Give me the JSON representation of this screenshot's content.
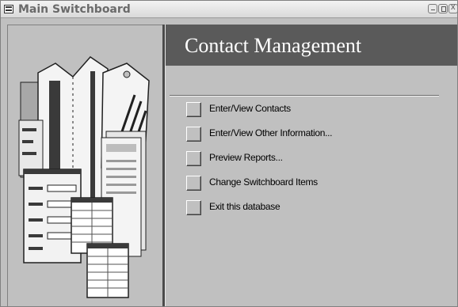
{
  "window": {
    "title": "Main Switchboard",
    "close_glyph": "x"
  },
  "header": {
    "title": "Contact Management"
  },
  "menu": {
    "items": [
      {
        "label": "Enter/View Contacts"
      },
      {
        "label": "Enter/View Other Information..."
      },
      {
        "label": "Preview Reports..."
      },
      {
        "label": "Change Switchboard Items"
      },
      {
        "label": "Exit this database"
      }
    ]
  },
  "icons": {
    "window_icon": "switchboard-form-icon",
    "illustration": "stacked-documents-illustration"
  },
  "colors": {
    "header_bg": "#5a5a5a",
    "header_text": "#ffffff",
    "panel_bg": "#c0c0c0"
  }
}
